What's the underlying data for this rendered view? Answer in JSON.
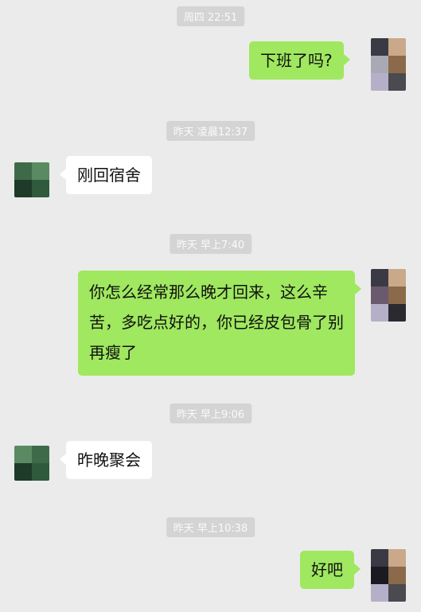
{
  "messages": [
    {
      "type": "time",
      "text": "周四 22:51"
    },
    {
      "type": "msg",
      "side": "right",
      "text": "下班了吗?"
    },
    {
      "type": "time",
      "text": "昨天 凌晨12:37"
    },
    {
      "type": "msg",
      "side": "left",
      "text": "刚回宿舍"
    },
    {
      "type": "time",
      "text": "昨天 早上7:40"
    },
    {
      "type": "msg",
      "side": "right",
      "text": "你怎么经常那么晚才回来，这么辛苦，多吃点好的，你已经皮包骨了别再瘦了"
    },
    {
      "type": "time",
      "text": "昨天 早上9:06"
    },
    {
      "type": "msg",
      "side": "left",
      "text": "昨晚聚会"
    },
    {
      "type": "time",
      "text": "昨天 早上10:38"
    },
    {
      "type": "msg",
      "side": "right",
      "text": "好吧"
    }
  ],
  "avatars": {
    "me": [
      "#4a4a50",
      "#c9a98a",
      "#a9a9b5",
      "#8a6a4a",
      "#b5b0c8",
      "#3a3a44"
    ],
    "other": [
      "#3f6a4a",
      "#5a8a62",
      "#1e3a28",
      "#2f5a3c"
    ]
  }
}
